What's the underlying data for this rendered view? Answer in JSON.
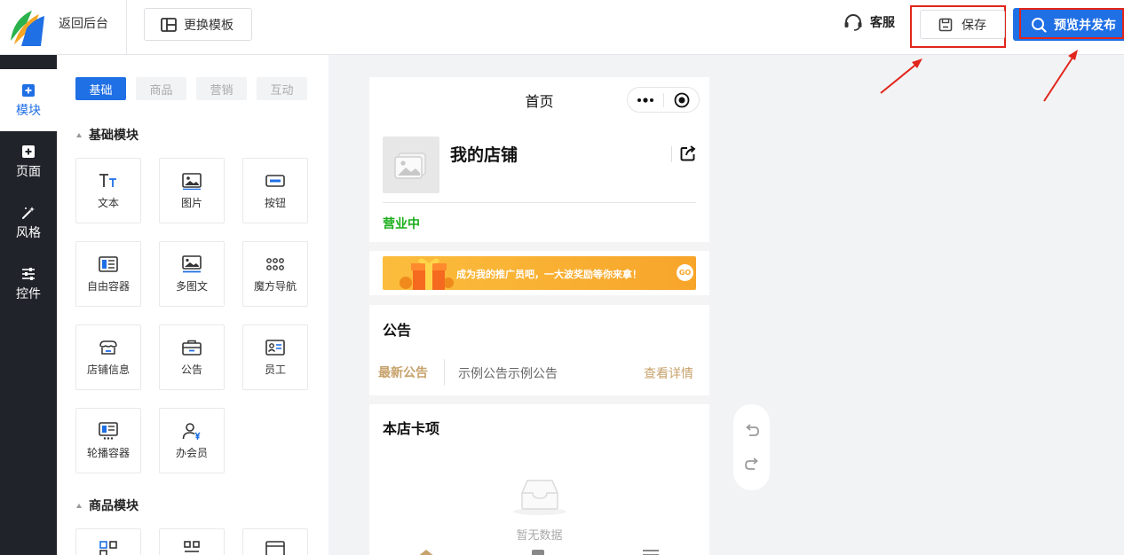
{
  "topbar": {
    "back_label": "返回后台",
    "template_label": "更换模板",
    "service_label": "客服",
    "save_label": "保存",
    "publish_label": "预览并发布"
  },
  "sidebar": {
    "items": [
      {
        "label": "模块",
        "icon": "plus-square-icon",
        "active": true
      },
      {
        "label": "页面",
        "icon": "plus-square-icon"
      },
      {
        "label": "风格",
        "icon": "magic-wand-icon"
      },
      {
        "label": "控件",
        "icon": "sliders-icon"
      }
    ]
  },
  "panel": {
    "tabs": [
      "基础",
      "商品",
      "营销",
      "互动"
    ],
    "active_tab": "基础",
    "basic_section_title": "基础模块",
    "basic_items": [
      {
        "label": "文本",
        "icon": "text-icon"
      },
      {
        "label": "图片",
        "icon": "image-icon"
      },
      {
        "label": "按钮",
        "icon": "button-icon"
      },
      {
        "label": "自由容器",
        "icon": "free-container-icon"
      },
      {
        "label": "多图文",
        "icon": "multi-image-text-icon"
      },
      {
        "label": "魔方导航",
        "icon": "cube-nav-icon"
      },
      {
        "label": "店铺信息",
        "icon": "store-info-icon"
      },
      {
        "label": "公告",
        "icon": "notice-icon"
      },
      {
        "label": "员工",
        "icon": "staff-icon"
      },
      {
        "label": "轮播容器",
        "icon": "carousel-icon"
      },
      {
        "label": "办会员",
        "icon": "membership-icon"
      }
    ],
    "goods_section_title": "商品模块"
  },
  "phone": {
    "title": "首页",
    "store_name": "我的店铺",
    "store_status": "营业中",
    "banner_text": "成为我的推广员吧，一大波奖励等你来拿！",
    "banner_go": "GO",
    "notice_title": "公告",
    "notice_tag": "最新公告",
    "notice_text": "示例公告示例公告",
    "notice_more": "查看详情",
    "cards_title": "本店卡项",
    "empty_text": "暂无数据"
  },
  "colors": {
    "accent": "#1f6fe5",
    "highlight": "#e1251b",
    "status_green": "#1aad19",
    "gold": "#c7a26c"
  }
}
